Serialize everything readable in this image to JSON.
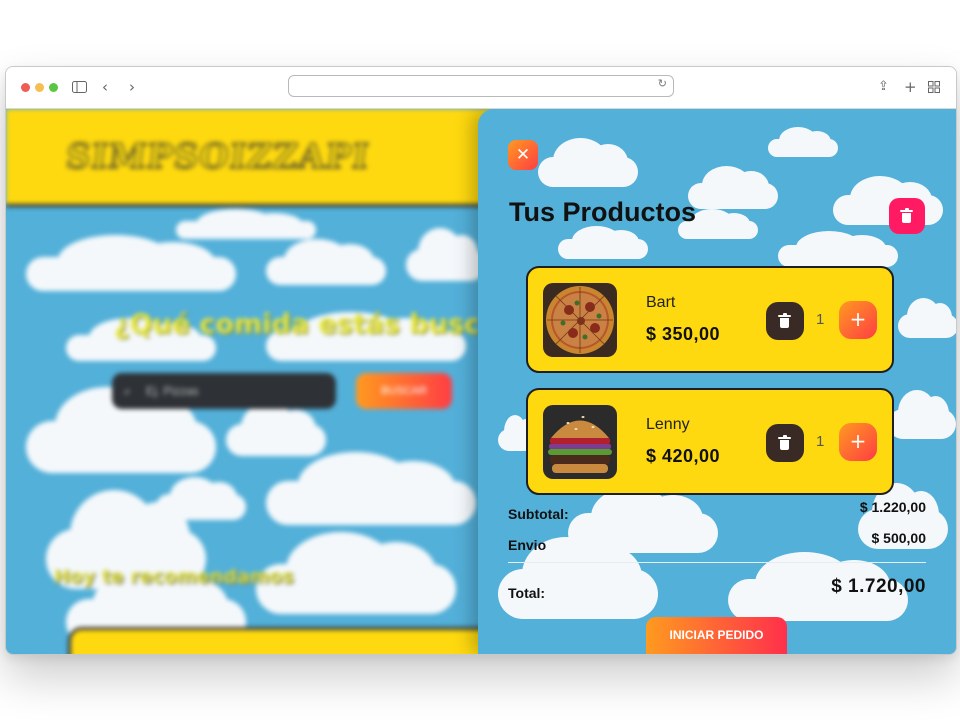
{
  "browser": {
    "traffic_lights": [
      "#ee5c54",
      "#f6be4f",
      "#5ac640"
    ],
    "icons": [
      "sidebar-icon",
      "back-icon",
      "forward-icon",
      "reload-icon",
      "share-icon",
      "new-tab-icon",
      "tab-overview-icon"
    ],
    "url": ""
  },
  "background_page": {
    "logo": "SIMPSOIZZAPI",
    "heading": "¿Qué comida estás buscando?",
    "search_placeholder": "Ej. Pizzas",
    "search_button": "BUSCAR",
    "recommend_heading": "Hoy te recomendamos",
    "colors": {
      "header": "#fed90f",
      "sky": "#53b0d9"
    }
  },
  "cart": {
    "title": "Tus Productos",
    "close_icon": "close-icon",
    "clear_icon": "trash-icon",
    "items": [
      {
        "name": "Bart",
        "price": "$ 350,00",
        "quantity": "1",
        "image": "pizza-photo"
      },
      {
        "name": "Lenny",
        "price": "$ 420,00",
        "quantity": "1",
        "image": "burger-photo"
      }
    ],
    "summary": {
      "subtotal_label": "Subtotal:",
      "subtotal_value": "$ 1.220,00",
      "shipping_label": "Envio",
      "shipping_value": "$ 500,00",
      "total_label": "Total:",
      "total_value": "$ 1.720,00"
    },
    "checkout_label": "INICIAR PEDIDO",
    "colors": {
      "accent_start": "#ff9a1f",
      "accent_end": "#ff3d44",
      "danger": "#ff1a63",
      "card": "#fed90f"
    }
  }
}
